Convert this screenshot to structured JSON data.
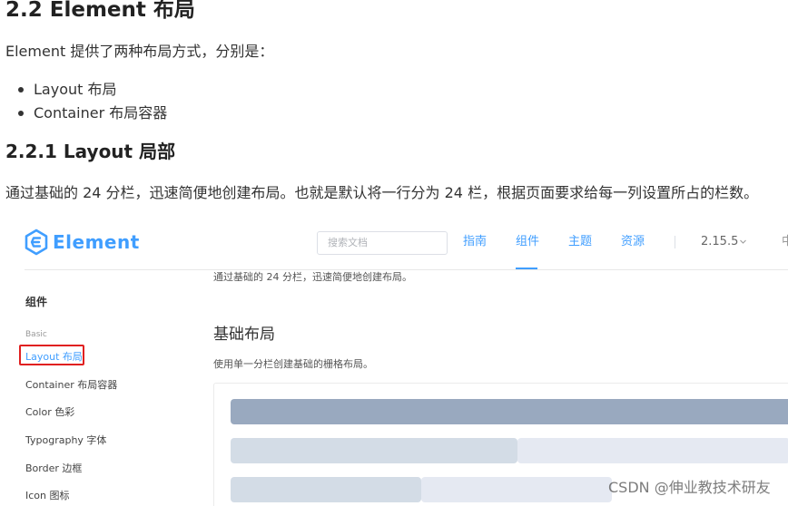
{
  "article": {
    "heading": "2.2 Element 布局",
    "intro": "Element 提供了两种布局方式，分别是：",
    "bullets": [
      "Layout 布局",
      "Container 布局容器"
    ],
    "subheading": "2.2.1 Layout 局部",
    "description": "通过基础的 24 分栏，迅速简便地创建布局。也就是默认将一行分为 24 栏，根据页面要求给每一列设置所占的栏数。"
  },
  "site": {
    "logo_text": "Element",
    "search_placeholder": "搜索文档",
    "nav": [
      "指南",
      "组件",
      "主题",
      "资源"
    ],
    "active_nav": "组件",
    "version": "2.15.5",
    "lang": "中",
    "colors": {
      "brand": "#409eff",
      "highlight_border": "#e02020"
    }
  },
  "sidebar": {
    "title": "组件",
    "group": "Basic",
    "items": [
      "Layout 布局",
      "Container 布局容器",
      "Color 色彩",
      "Typography 字体",
      "Border 边框",
      "Icon 图标"
    ],
    "active_item": "Layout 布局"
  },
  "content": {
    "intro": "通过基础的 24 分栏，迅速简便地创建布局。",
    "heading": "基础布局",
    "subtext": "使用单一分栏创建基础的栅格布局。"
  },
  "watermark": "CSDN @伸业教技术研友"
}
